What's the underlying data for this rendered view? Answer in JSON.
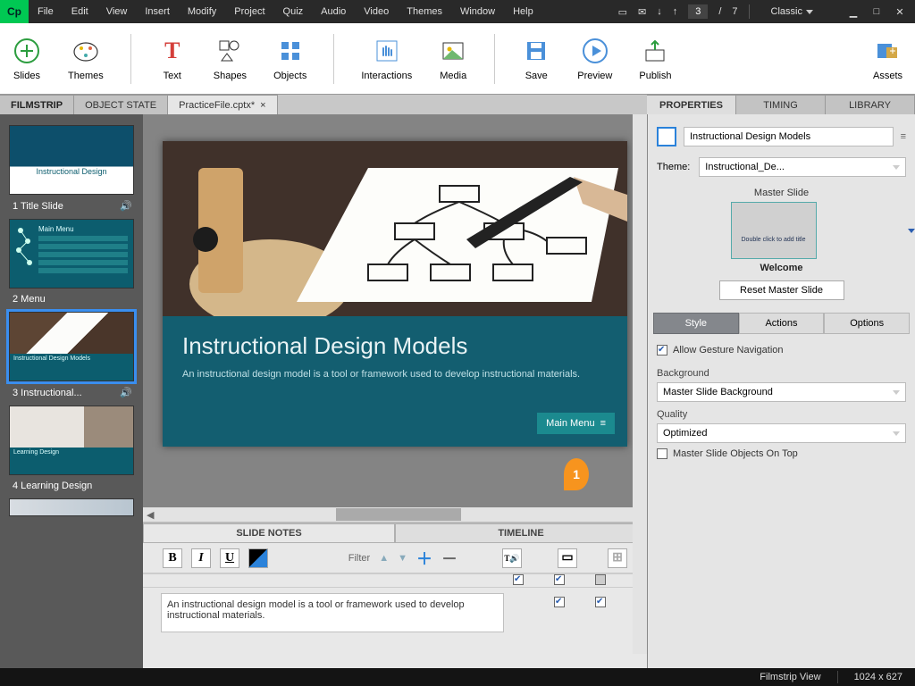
{
  "menu": {
    "items": [
      "File",
      "Edit",
      "View",
      "Insert",
      "Modify",
      "Project",
      "Quiz",
      "Audio",
      "Video",
      "Themes",
      "Window",
      "Help"
    ],
    "current_slide": "3",
    "total_slides": "7",
    "layout": "Classic"
  },
  "ribbon": [
    "Slides",
    "Themes",
    "Text",
    "Shapes",
    "Objects",
    "Interactions",
    "Media",
    "Save",
    "Preview",
    "Publish",
    "Assets"
  ],
  "docbar": {
    "filmstrip": "FILMSTRIP",
    "objstate": "OBJECT STATE",
    "file": "PracticeFile.cptx*"
  },
  "rightTabs": [
    "PROPERTIES",
    "TIMING",
    "LIBRARY"
  ],
  "thumbs": [
    {
      "label": "1 Title Slide",
      "audio": true,
      "title": "Instructional Design"
    },
    {
      "label": "2 Menu",
      "audio": false,
      "title": "Main Menu"
    },
    {
      "label": "3 Instructional...",
      "audio": true,
      "title": "Instructional Design Models"
    },
    {
      "label": "4 Learning Design",
      "audio": false,
      "title": "Learning Design"
    }
  ],
  "slide": {
    "title": "Instructional Design Models",
    "subtitle": "An instructional design model is a tool or framework used to develop instructional materials.",
    "menuBtn": "Main Menu"
  },
  "bottomTabs": {
    "notes": "SLIDE NOTES",
    "timeline": "TIMELINE"
  },
  "notesToolbar": {
    "filter": "Filter"
  },
  "noteText": "An instructional design model is a tool or framework used to develop instructional materials.",
  "annotation": "1",
  "props": {
    "name": "Instructional Design Models",
    "themeLabel": "Theme:",
    "themeValue": "Instructional_De...",
    "masterLabel": "Master Slide",
    "masterThumbText": "Double click to add title",
    "masterName": "Welcome",
    "resetBtn": "Reset Master Slide",
    "styleTabs": [
      "Style",
      "Actions",
      "Options"
    ],
    "allowGesture": "Allow Gesture Navigation",
    "bgLabel": "Background",
    "bgVal": "Master Slide Background",
    "qLabel": "Quality",
    "qVal": "Optimized",
    "masterOnTop": "Master Slide Objects On Top"
  },
  "status": {
    "view": "Filmstrip View",
    "dim": "1024 x 627"
  }
}
